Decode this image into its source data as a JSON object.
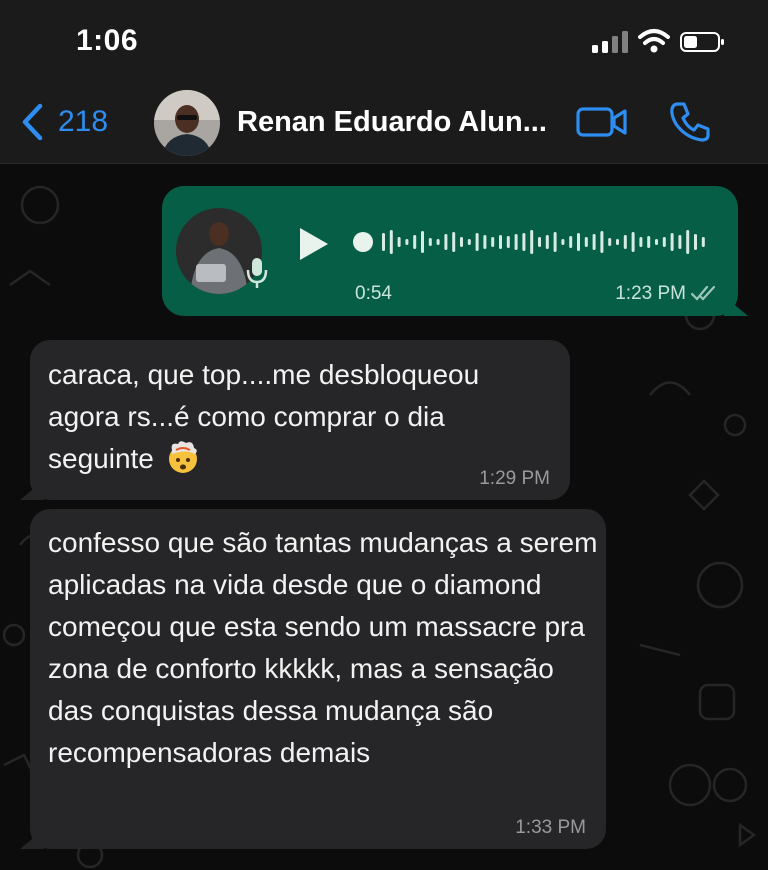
{
  "status_bar": {
    "time": "1:06"
  },
  "header": {
    "back_count": "218",
    "contact_name": "Renan Eduardo Alun..."
  },
  "messages": [
    {
      "type": "voice",
      "direction": "outgoing",
      "duration": "0:54",
      "time": "1:23 PM",
      "status": "read"
    },
    {
      "type": "text",
      "direction": "incoming",
      "text": "caraca, que top....me desbloqueou agora rs...é como comprar o dia seguinte",
      "emoji": "exploding-head-emoji",
      "time": "1:29 PM"
    },
    {
      "type": "text",
      "direction": "incoming",
      "text": "confesso que são tantas mudanças a serem aplicadas na vida desde que o diamond começou que esta sendo um massacre pra zona de conforto kkkkk, mas a sensação das conquistas dessa mudança são recompensadoras demais",
      "time": "1:33 PM"
    }
  ],
  "colors": {
    "accent": "#2e8df0",
    "outgoing_bubble": "#075e47",
    "incoming_bubble": "#262628",
    "background": "#0c0c0c"
  }
}
